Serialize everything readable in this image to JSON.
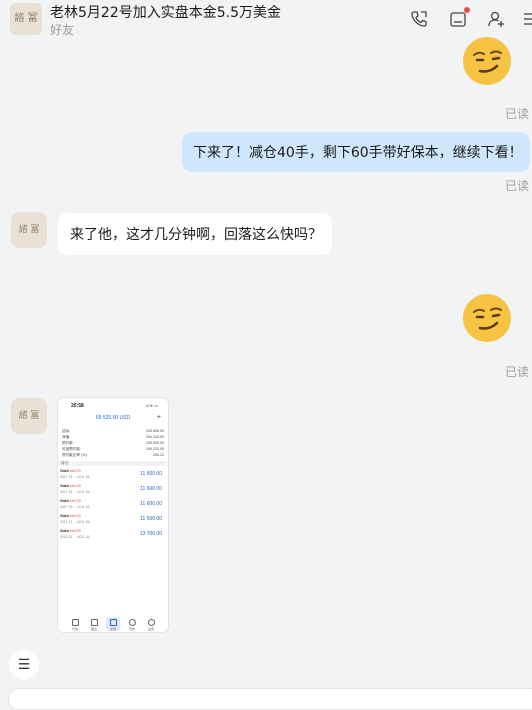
{
  "header": {
    "title": "老林5月22号加入实盘本金5.5万美金",
    "subtitle": "好友",
    "avatar_text": "諮 冨",
    "icons": [
      "call-icon",
      "notes-icon",
      "add-user-icon",
      "more-icon"
    ],
    "notification_dot_color": "#f24a44"
  },
  "messages": [
    {
      "type": "emoji",
      "sender": "me",
      "icon": "smirk-emoji-icon",
      "status": "已读"
    },
    {
      "type": "text",
      "sender": "me",
      "text": "下来了！减仓40手，剩下60手带好保本，继续下看！",
      "status": "已读"
    },
    {
      "type": "text",
      "sender": "other",
      "text": "来了他，这才几分钟啊，回落这么快吗？"
    },
    {
      "type": "emoji",
      "sender": "me",
      "icon": "smirk-emoji-icon",
      "status": "已读"
    },
    {
      "type": "image",
      "sender": "other",
      "description_icon": "trading-app-screenshot"
    }
  ],
  "screenshot": {
    "time": "20:58",
    "status": "ııl ≋ ▭",
    "balance": "69 520.00 USD",
    "rows": [
      {
        "k": "结余:",
        "v": "194 600.00"
      },
      {
        "k": "净值:",
        "v": "254 120.00"
      },
      {
        "k": "预付款:",
        "v": "100 000.00"
      },
      {
        "k": "可用预付款:",
        "v": "154 120.00"
      },
      {
        "k": "预付款比率 (%):",
        "v": "254.12"
      }
    ],
    "section_label": "持仓",
    "section_more": "···",
    "positions": [
      {
        "sym": "Gold",
        "tag": "sell 20",
        "px": "4017.19 → 4011.46",
        "pl": "11 600.00"
      },
      {
        "sym": "Gold",
        "tag": "sell 20",
        "px": "4017.19 → 4011.46",
        "pl": "11 600.00"
      },
      {
        "sym": "Gold",
        "tag": "sell 20",
        "px": "4017.20 → 4011.46",
        "pl": "11 600.00"
      },
      {
        "sym": "Gold",
        "tag": "sell 20",
        "px": "4017.21 → 4011.46",
        "pl": "11 500.00"
      },
      {
        "sym": "Gold",
        "tag": "sell 20",
        "px": "4018.31 → 4011.46",
        "pl": "13 700.00"
      }
    ],
    "tabs": [
      "行情",
      "图表",
      "交易",
      "历史",
      "设置"
    ],
    "active_tab": 2
  },
  "composer": {
    "menu_icon": "☰"
  }
}
